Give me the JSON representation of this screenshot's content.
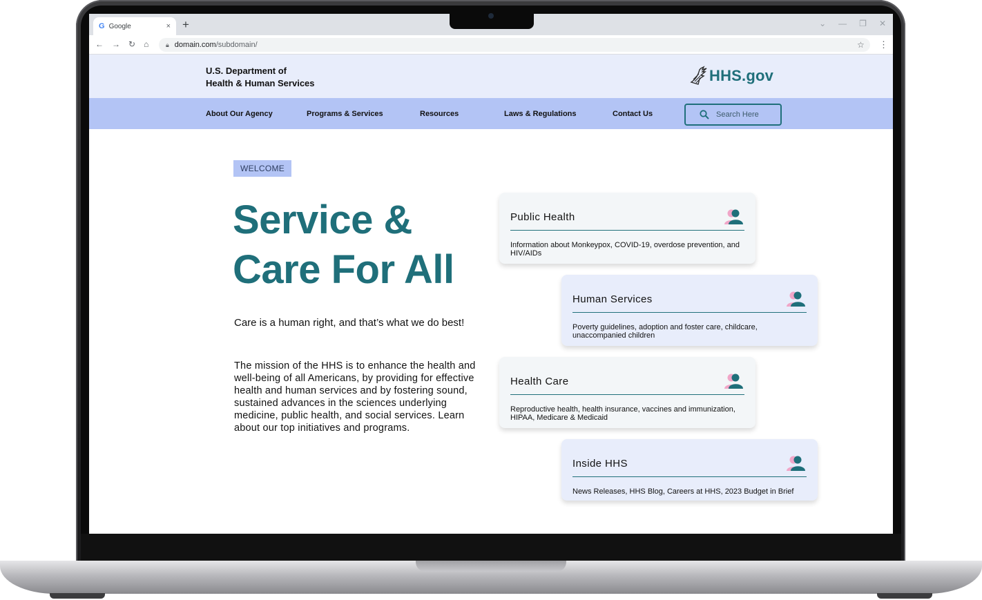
{
  "browser": {
    "tab_title": "Google",
    "tab_favicon": "G",
    "tab_close": "×",
    "new_tab": "+",
    "url_domain": "domain.com",
    "url_path": "/subdomain/",
    "icons": [
      "back-icon",
      "forward-icon",
      "reload-icon",
      "home-icon",
      "lock-icon",
      "star-icon",
      "menu-icon"
    ]
  },
  "header": {
    "dept_line1": "U.S. Department of",
    "dept_line2": "Health & Human Services",
    "logo_text": "HHS.gov",
    "logo_icon": "eagle-icon"
  },
  "nav": {
    "items": [
      "About Our Agency",
      "Programs & Services",
      "Resources",
      "Laws & Regulations",
      "Contact Us"
    ],
    "search_placeholder": "Search Here"
  },
  "hero": {
    "badge": "WELCOME",
    "title_line1": "Service &",
    "title_line2": "Care For All",
    "tagline": "Care is a human right, and that’s what we do best!",
    "mission": "The mission of the HHS is to enhance the health and well-being of all Americans, by providing for effective health and human services and by fostering sound, sustained advances in the sciences underlying medicine, public health, and social services. Learn about our top initiatives and programs."
  },
  "cards": [
    {
      "title": "Public Health",
      "desc": "Information about Monkeypox, COVID-19, overdose prevention, and HIV/AIDs",
      "icon": "people-icon"
    },
    {
      "title": "Human Services",
      "desc": "Poverty guidelines, adoption and foster care, childcare, unaccompanied children",
      "icon": "people-icon"
    },
    {
      "title": "Health Care",
      "desc": "Reproductive health, health insurance, vaccines and immunization, HIPAA, Medicare & Medicaid",
      "icon": "people-icon"
    },
    {
      "title": "Inside HHS",
      "desc": "News Releases, HHS Blog, Careers at HHS, 2023 Budget in Brief",
      "icon": "people-icon"
    }
  ],
  "colors": {
    "teal": "#1f6f7a",
    "nav_blue": "#b3c4f5",
    "header_blue": "#e8edfb",
    "card_gray": "#f3f6f8",
    "icon_pink": "#f0a6c8"
  }
}
